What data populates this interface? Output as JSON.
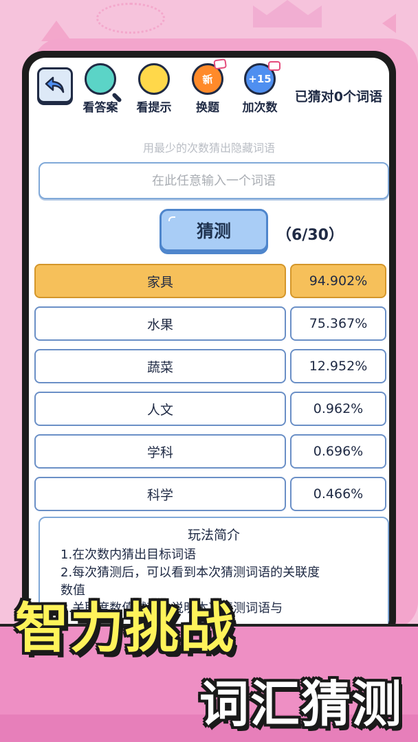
{
  "toolbar": {
    "tools": [
      {
        "label": "看答案",
        "icon": "magnifier-icon"
      },
      {
        "label": "看提示",
        "icon": "lightbulb-icon"
      },
      {
        "label": "换题",
        "icon": "new-icon",
        "glyph": "新"
      },
      {
        "label": "加次数",
        "icon": "plus15-icon",
        "glyph": "+15"
      }
    ],
    "score_text": "已猜对0个词语"
  },
  "subtitle": "用最少的次数猜出隐藏词语",
  "input": {
    "placeholder": "在此任意输入一个词语",
    "value": ""
  },
  "guess_button": {
    "label": "猜测"
  },
  "counter": "（6/30）",
  "results": [
    {
      "word": "家具",
      "pct": "94.902%",
      "highlight": true
    },
    {
      "word": "水果",
      "pct": "75.367%"
    },
    {
      "word": "蔬菜",
      "pct": "12.952%"
    },
    {
      "word": "人文",
      "pct": "0.962%"
    },
    {
      "word": "学科",
      "pct": "0.696%"
    },
    {
      "word": "科学",
      "pct": "0.466%"
    }
  ],
  "rules": {
    "title": "玩法简介",
    "line1": "1.在次数内猜出目标词语",
    "line2": "2.每次猜测后，可以看到本次猜测词语的关联度",
    "line2b": "数值",
    "line3": "3.关联度数值越高，说明本次猜测词语与"
  },
  "promo": {
    "line1": "智力挑战",
    "line2": "词汇猜测"
  },
  "colors": {
    "background": "#f6c3dc",
    "highlight": "#f6c05a",
    "button": "#a9cdf6",
    "banner": "#ee8fc4",
    "promo_yellow": "#fff35a"
  }
}
